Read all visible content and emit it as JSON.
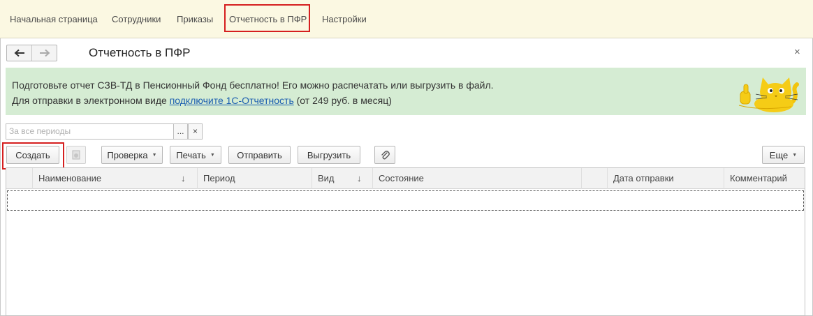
{
  "top_nav": {
    "items": [
      "Начальная страница",
      "Сотрудники",
      "Приказы",
      "Отчетность в ПФР",
      "Настройки"
    ]
  },
  "page": {
    "title": "Отчетность в ПФР",
    "close": "×"
  },
  "banner": {
    "line1": "Подготовьте отчет СЗВ-ТД в Пенсионный Фонд бесплатно! Его можно распечатать или выгрузить в файл.",
    "line2_prefix": "Для отправки в электронном виде ",
    "line2_link": "подключите 1С-Отчетность",
    "line2_suffix": " (от 249 руб. в месяц)"
  },
  "filter": {
    "placeholder": "За все периоды",
    "select_label": "...",
    "clear_label": "×"
  },
  "toolbar": {
    "create": "Создать",
    "check": "Проверка",
    "print": "Печать",
    "send": "Отправить",
    "export": "Выгрузить",
    "more": "Еще"
  },
  "table": {
    "columns": [
      "Наименование",
      "Период",
      "Вид",
      "Состояние",
      "",
      "Дата отправки",
      "Комментарий"
    ],
    "sort_indicator": "↓",
    "rows": []
  },
  "colors": {
    "nav_bg": "#fbf8e2",
    "banner_bg": "#d5ecd3",
    "highlight": "#d51f1f",
    "link": "#1b5eb0"
  }
}
